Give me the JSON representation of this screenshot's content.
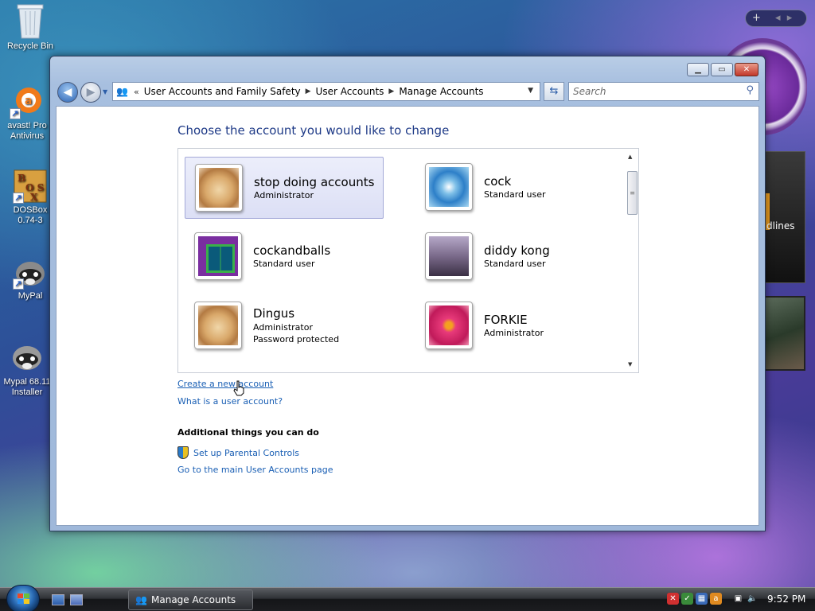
{
  "desktop": {
    "icons": [
      {
        "label": "Recycle Bin"
      },
      {
        "label": "avast! Pro Antivirus"
      },
      {
        "label": "DOSBox 0.74-3"
      },
      {
        "label": "MyPal"
      },
      {
        "label": "Mypal 68.11 Installer"
      }
    ],
    "gadgets": {
      "feed_text": "dlines"
    }
  },
  "window": {
    "address": {
      "crumbs": [
        "User Accounts and Family Safety",
        "User Accounts",
        "Manage Accounts"
      ],
      "overflow": "«"
    },
    "search": {
      "placeholder": "Search"
    },
    "title": "Choose the account you would like to change",
    "accounts": [
      {
        "name": "stop doing accounts",
        "type": "Administrator",
        "extra": "",
        "picture": "dog",
        "selected": true
      },
      {
        "name": "cock",
        "type": "Standard user",
        "extra": "",
        "picture": "flower",
        "selected": false
      },
      {
        "name": "cockandballs",
        "type": "Standard user",
        "extra": "",
        "picture": "window",
        "selected": false
      },
      {
        "name": "diddy kong",
        "type": "Standard user",
        "extra": "",
        "picture": "grass",
        "selected": false
      },
      {
        "name": "Dingus",
        "type": "Administrator",
        "extra": "Password protected",
        "picture": "dog",
        "selected": false
      },
      {
        "name": "FORKIE",
        "type": "Administrator",
        "extra": "",
        "picture": "daisy",
        "selected": false
      }
    ],
    "links": {
      "create": "Create a new account",
      "what": "What is a user account?",
      "additional_heading": "Additional things you can do",
      "parental": "Set up Parental Controls",
      "main_page": "Go to the main User Accounts page"
    }
  },
  "taskbar": {
    "task_label": "Manage Accounts",
    "clock": "9:52 PM"
  },
  "colors": {
    "link": "#1a5fb4",
    "title": "#1e3a87",
    "selected_bg": "#dcdff5"
  }
}
